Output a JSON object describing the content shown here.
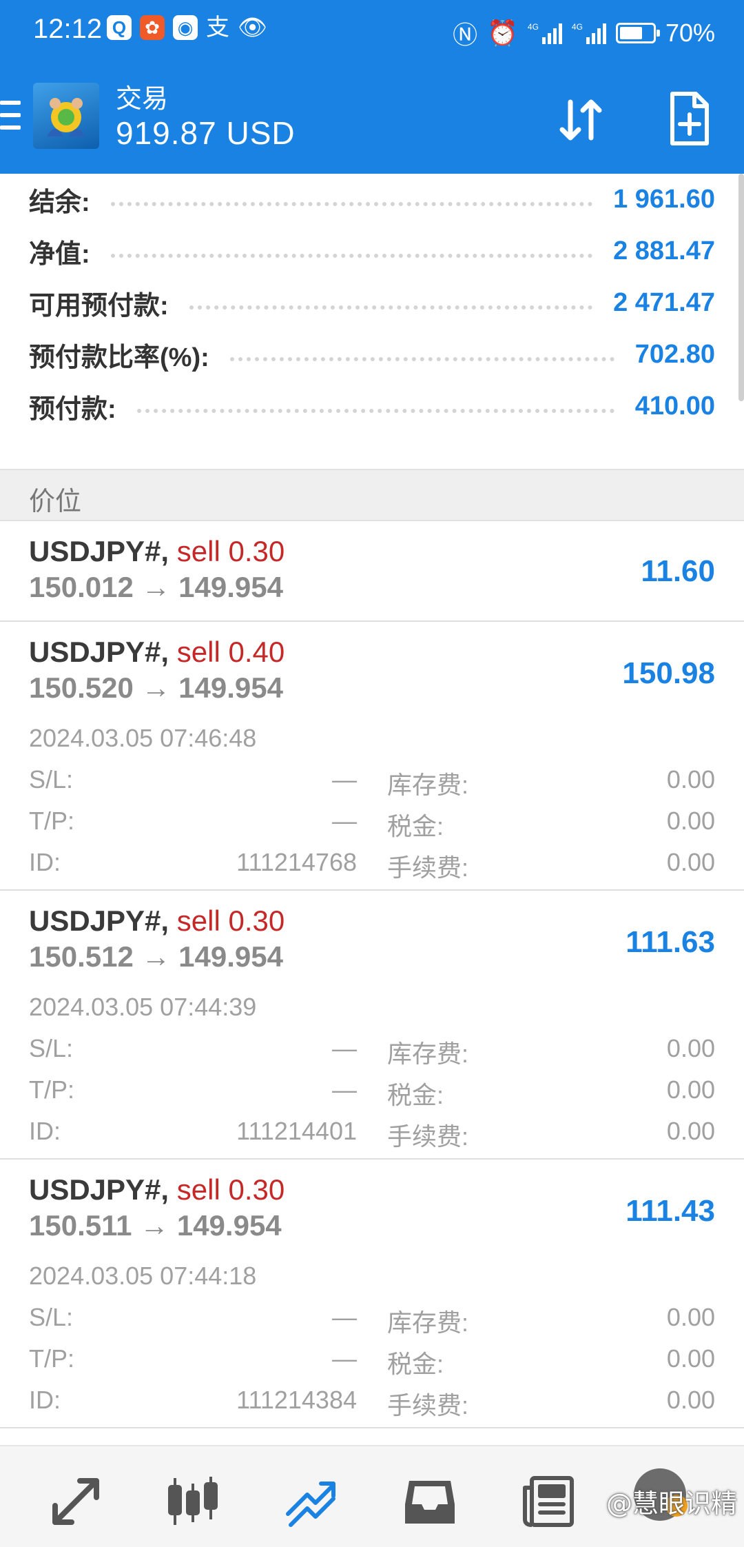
{
  "status_bar": {
    "time": "12:12",
    "left_icons": [
      "q-app-icon",
      "bag-app-icon",
      "browser-icon",
      "alipay-icon",
      "eye-icon"
    ],
    "right_icons": [
      "nfc-icon",
      "alarm-icon",
      "signal-4g-icon",
      "signal-4g-icon",
      "battery-icon"
    ],
    "battery": "70%",
    "battery_level": 0.7
  },
  "app_bar": {
    "subtitle": "交易",
    "balance": "919.87 USD"
  },
  "summary": [
    {
      "label": "结余:",
      "value": "1 961.60"
    },
    {
      "label": "净值:",
      "value": "2 881.47"
    },
    {
      "label": "可用预付款:",
      "value": "2 471.47"
    },
    {
      "label": "预付款比率(%):",
      "value": "702.80"
    },
    {
      "label": "预付款:",
      "value": "410.00"
    }
  ],
  "section_header": "价位",
  "positions": [
    {
      "symbol": "USDJPY#,",
      "side": "sell 0.30",
      "prices": "150.012 → 149.954",
      "profit": "11.60"
    },
    {
      "symbol": "USDJPY#,",
      "side": "sell 0.40",
      "prices": "150.520 → 149.954",
      "profit": "150.98",
      "date": "2024.03.05 07:46:48",
      "sl_label": "S/L:",
      "sl": "—",
      "tp_label": "T/P:",
      "tp": "—",
      "id_label": "ID:",
      "id": "111214768",
      "swap_label": "库存费:",
      "swap": "0.00",
      "tax_label": "税金:",
      "tax": "0.00",
      "fee_label": "手续费:",
      "fee": "0.00"
    },
    {
      "symbol": "USDJPY#,",
      "side": "sell 0.30",
      "prices": "150.512 → 149.954",
      "profit": "111.63",
      "date": "2024.03.05 07:44:39",
      "sl_label": "S/L:",
      "sl": "—",
      "tp_label": "T/P:",
      "tp": "—",
      "id_label": "ID:",
      "id": "111214401",
      "swap_label": "库存费:",
      "swap": "0.00",
      "tax_label": "税金:",
      "tax": "0.00",
      "fee_label": "手续费:",
      "fee": "0.00"
    },
    {
      "symbol": "USDJPY#,",
      "side": "sell 0.30",
      "prices": "150.511 → 149.954",
      "profit": "111.43",
      "date": "2024.03.05 07:44:18",
      "sl_label": "S/L:",
      "sl": "—",
      "tp_label": "T/P:",
      "tp": "—",
      "id_label": "ID:",
      "id": "111214384",
      "swap_label": "库存费:",
      "swap": "0.00",
      "tax_label": "税金:",
      "tax": "0.00",
      "fee_label": "手续费:",
      "fee": "0.00"
    }
  ],
  "bottom_nav": [
    "quotes-icon",
    "chart-icon",
    "trade-icon",
    "history-icon",
    "news-icon"
  ],
  "watermark": "@慧眼识精",
  "colors": {
    "accent": "#1a82e2",
    "sell": "#c62828",
    "nav_active": "#1a82e2"
  }
}
